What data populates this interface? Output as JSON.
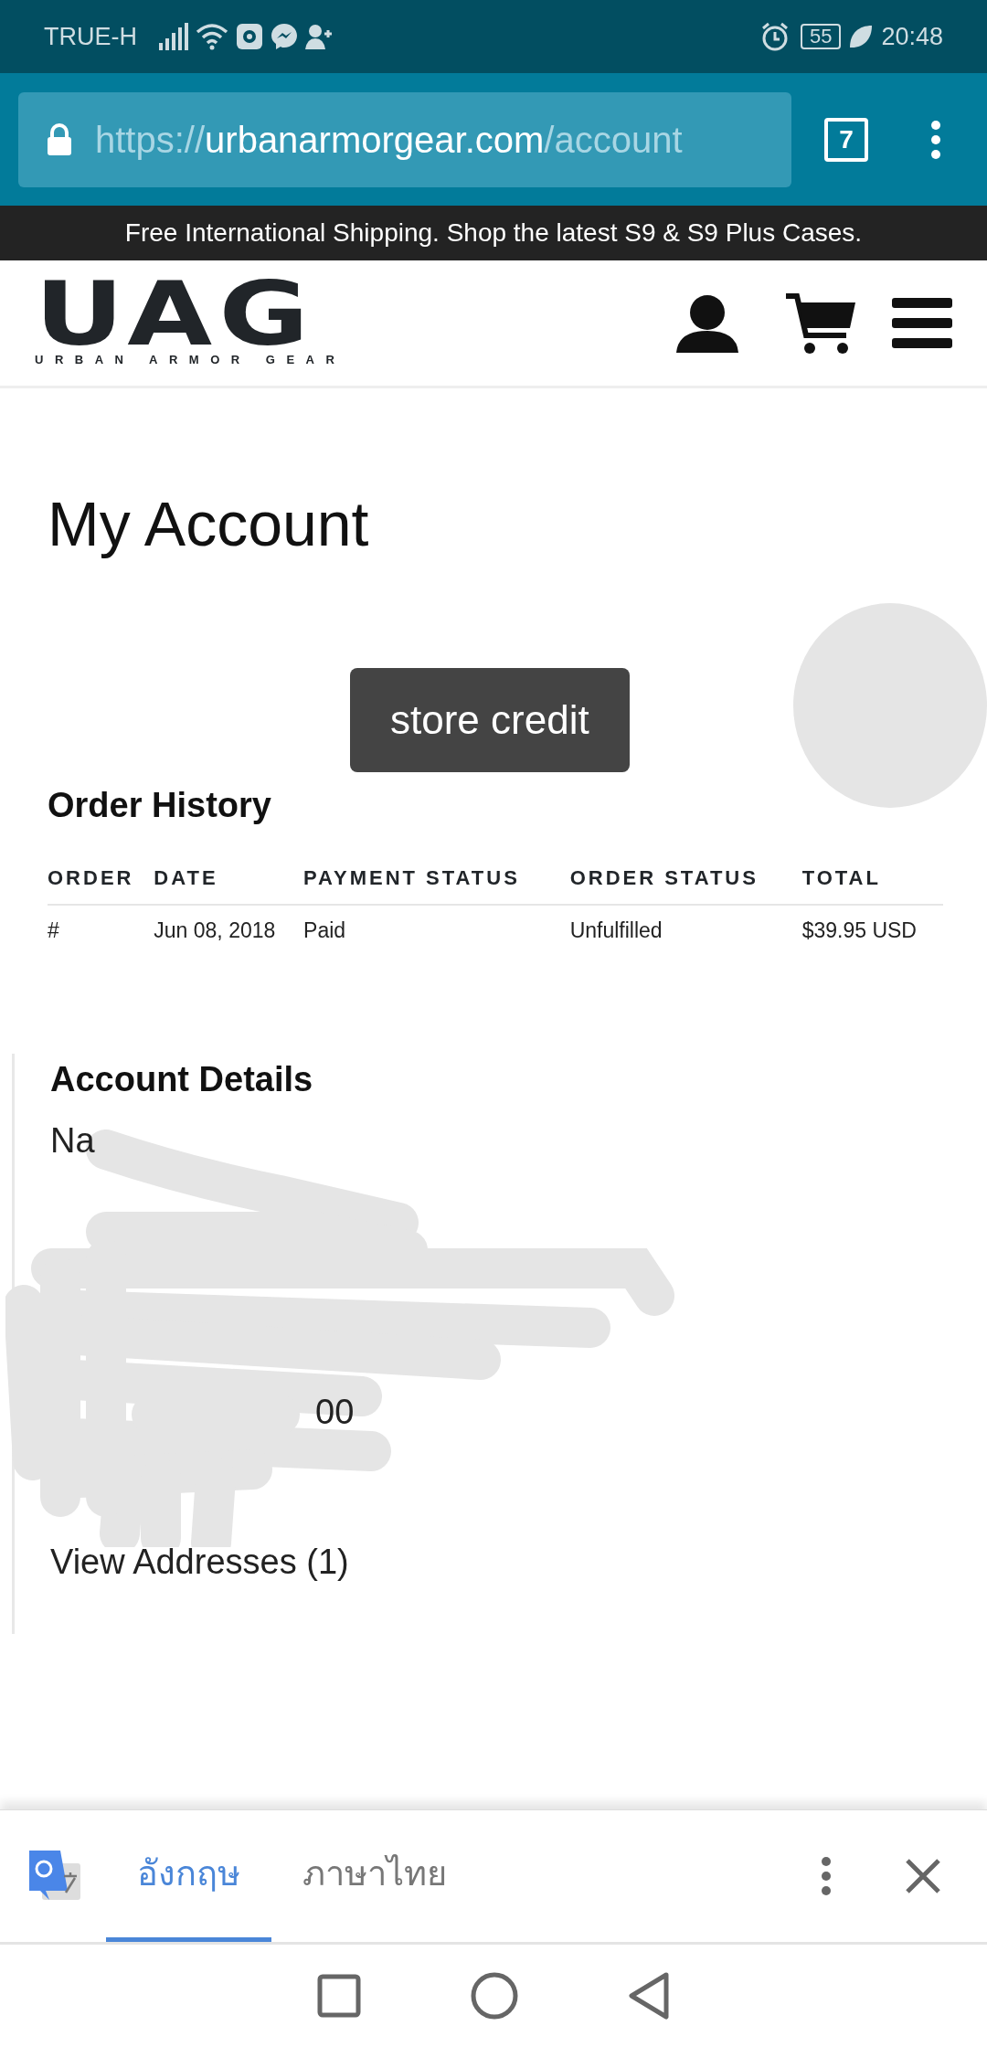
{
  "status_bar": {
    "carrier": "TRUE-H",
    "battery": "55",
    "time": "20:48"
  },
  "browser": {
    "url_scheme": "https://",
    "url_host": "urbanarmorgear.com",
    "url_path": "/account",
    "tab_count": "7"
  },
  "promo_banner": "Free International Shipping. Shop the latest S9 & S9 Plus Cases.",
  "logo": {
    "mark": "UAG",
    "tagline": "URBAN ARMOR GEAR"
  },
  "page_title": "My Account",
  "store_credit_button": "store credit",
  "order_history": {
    "title": "Order History",
    "columns": [
      "ORDER",
      "DATE",
      "PAYMENT STATUS",
      "ORDER STATUS",
      "TOTAL"
    ],
    "rows": [
      {
        "order": "#",
        "date": "Jun 08, 2018",
        "payment_status": "Paid",
        "order_status": "Unfulfilled",
        "total": "$39.95 USD"
      }
    ]
  },
  "account_details": {
    "title": "Account Details",
    "lines": [
      "Na",
      "00"
    ],
    "link": "View Addresses (1)"
  },
  "translate_bar": {
    "tabs": [
      {
        "label": "อังกฤษ",
        "selected": true
      },
      {
        "label": "ภาษาไทย",
        "selected": false
      }
    ]
  }
}
